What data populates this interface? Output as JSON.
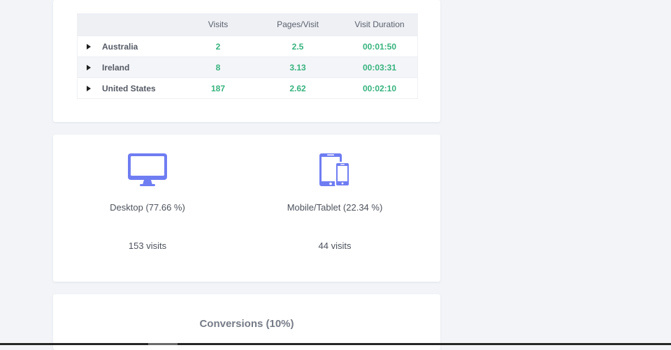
{
  "table": {
    "headers": {
      "country": "",
      "visits": "Visits",
      "pages": "Pages/Visit",
      "duration": "Visit Duration"
    },
    "rows": [
      {
        "country": "Australia",
        "visits": "2",
        "pages": "2.5",
        "duration": "00:01:50"
      },
      {
        "country": "Ireland",
        "visits": "8",
        "pages": "3.13",
        "duration": "00:03:31"
      },
      {
        "country": "United States",
        "visits": "187",
        "pages": "2.62",
        "duration": "00:02:10"
      }
    ],
    "value_color": "#36b37e"
  },
  "devices": {
    "icon_color": "#6f7df2",
    "desktop": {
      "icon": "desktop-monitor-icon",
      "label": "Desktop (77.66 %)",
      "visits": "153 visits"
    },
    "mobile": {
      "icon": "mobile-tablet-icon",
      "label": "Mobile/Tablet (22.34 %)",
      "visits": "44 visits"
    }
  },
  "conversions": {
    "title": "Conversions (10%)"
  }
}
